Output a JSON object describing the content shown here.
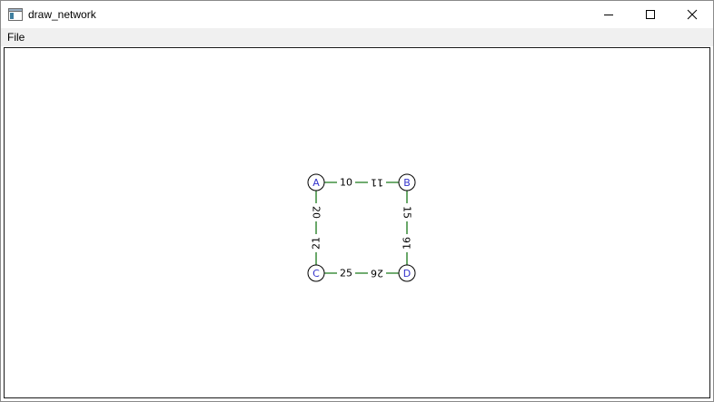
{
  "window": {
    "title": "draw_network"
  },
  "menu": {
    "file_label": "File"
  },
  "colors": {
    "edge": "#1a7a1a",
    "node_label": "#3333cc",
    "node_border": "#000000",
    "edge_label": "#000000"
  },
  "network": {
    "nodes": [
      "A",
      "B",
      "C",
      "D"
    ],
    "edges": [
      {
        "from": "A",
        "to": "B",
        "label_near_from": "10",
        "label_near_to": "11"
      },
      {
        "from": "A",
        "to": "C",
        "label_near_from": "20",
        "label_near_to": "21"
      },
      {
        "from": "B",
        "to": "D",
        "label_near_from": "15",
        "label_near_to": "16"
      },
      {
        "from": "C",
        "to": "D",
        "label_near_from": "25",
        "label_near_to": "26"
      }
    ]
  }
}
